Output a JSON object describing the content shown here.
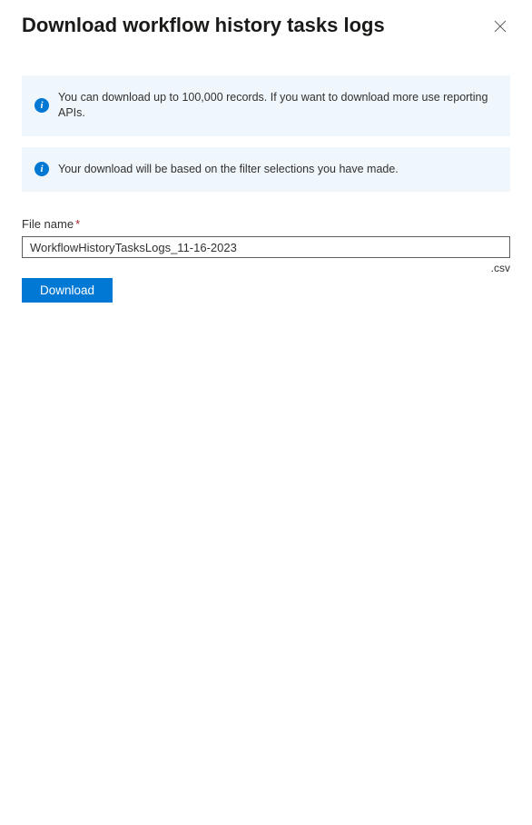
{
  "header": {
    "title": "Download workflow history tasks logs"
  },
  "info": {
    "records": "You can download up to 100,000 records. If you want to download more use reporting APIs.",
    "filter": "Your download will be based on the filter selections you have made."
  },
  "form": {
    "file_name_label": "File name",
    "file_name_value": "WorkflowHistoryTasksLogs_11-16-2023",
    "extension": ".csv",
    "download_label": "Download"
  }
}
